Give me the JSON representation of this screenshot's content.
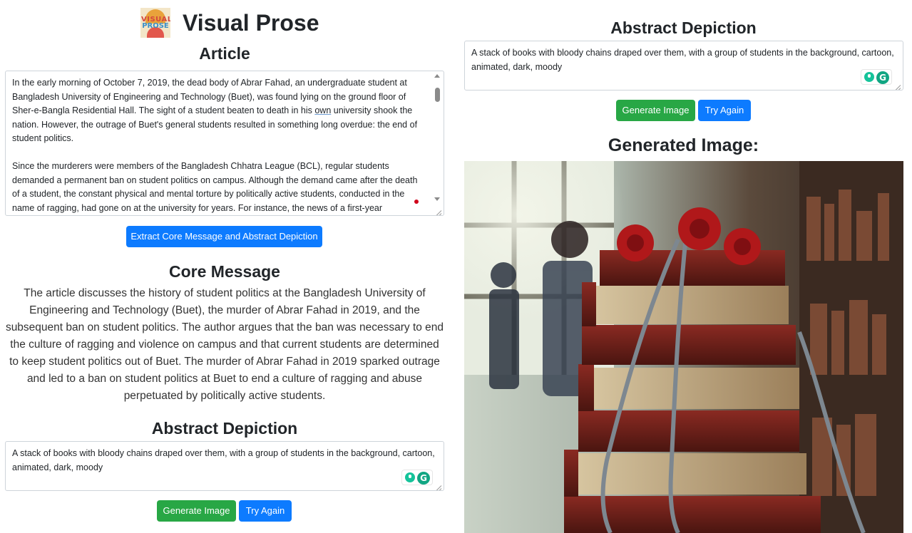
{
  "app": {
    "title": "Visual Prose",
    "logo_line1": "VISUAL",
    "logo_line2": "PROSE"
  },
  "article": {
    "heading": "Article",
    "paragraph1_pre": "In the early morning of October 7, 2019, the dead body of Abrar Fahad, an undergraduate student at Bangladesh University of Engineering and Technology (Buet), was found lying on the ground floor of Sher-e-Bangla Residential Hall. The sight of a student beaten to death in his ",
    "paragraph1_underlined": "own",
    "paragraph1_post": " university shook the nation. However, the outrage of Buet's general students resulted in something long overdue: the end of student politics.",
    "paragraph2": "Since the murderers were members of the Bangladesh Chhatra League (BCL), regular students demanded a permanent ban on student politics on campus. Although the demand came after the death of a student, the constant physical and mental torture by politically active students, conducted in the name of ragging, had gone on at the university for years. For instance, the news of a first-year"
  },
  "extract_button": "Extract Core Message and Abstract Depiction",
  "core_message": {
    "heading": "Core Message",
    "text": "The article discusses the history of student politics at the Bangladesh University of Engineering and Technology (Buet), the murder of Abrar Fahad in 2019, and the subsequent ban on student politics. The author argues that the ban was necessary to end the culture of ragging and violence on campus and that current students are determined to keep student politics out of Buet. The murder of Abrar Fahad in 2019 sparked outrage and led to a ban on student politics at Buet to end a culture of ragging and abuse perpetuated by politically active students."
  },
  "abstract_depiction": {
    "heading": "Abstract Depiction",
    "text": "A stack of books with bloody chains draped over them, with a group of students in the background, cartoon, animated, dark, moody"
  },
  "buttons": {
    "generate": "Generate Image",
    "try_again": "Try Again"
  },
  "generated": {
    "heading": "Generated Image:"
  },
  "grammarly": {
    "g": "G"
  },
  "colors": {
    "primary": "#0d7bff",
    "success": "#28a745"
  }
}
